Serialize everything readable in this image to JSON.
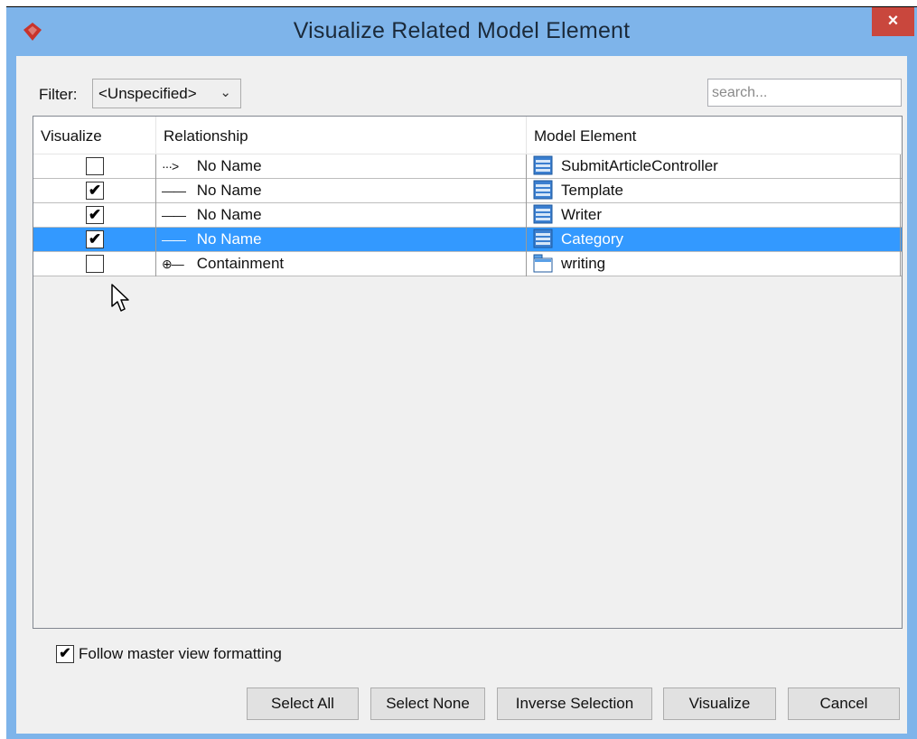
{
  "window": {
    "title": "Visualize Related Model Element",
    "close_label": "×"
  },
  "filter": {
    "label": "Filter:",
    "value": "<Unspecified>",
    "arrow": "⌄"
  },
  "search": {
    "placeholder": "search...",
    "value": ""
  },
  "table": {
    "columns": [
      "Visualize",
      "Relationship",
      "Model Element"
    ],
    "rows": [
      {
        "checked": false,
        "check_glyph": "",
        "rel_glyph": "···>",
        "relationship": "No Name",
        "element_icon": "class-icon",
        "model_element": "SubmitArticleController",
        "selected": false
      },
      {
        "checked": true,
        "check_glyph": "✔",
        "rel_glyph": "——",
        "relationship": "No Name",
        "element_icon": "class-icon",
        "model_element": "Template",
        "selected": false
      },
      {
        "checked": true,
        "check_glyph": "✔",
        "rel_glyph": "——",
        "relationship": "No Name",
        "element_icon": "class-icon",
        "model_element": "Writer",
        "selected": false
      },
      {
        "checked": true,
        "check_glyph": "✔",
        "rel_glyph": "——",
        "relationship": "No Name",
        "element_icon": "class-icon",
        "model_element": "Category",
        "selected": true
      },
      {
        "checked": false,
        "check_glyph": "",
        "rel_glyph": "⊕—",
        "relationship": "Containment",
        "element_icon": "package-icon",
        "model_element": "writing",
        "selected": false
      }
    ]
  },
  "follow_master": {
    "checked": true,
    "check_glyph": "✔",
    "label": "Follow master view formatting"
  },
  "buttons": {
    "select_all": "Select All",
    "select_none": "Select None",
    "inverse_selection": "Inverse Selection",
    "visualize": "Visualize",
    "cancel": "Cancel"
  },
  "colors": {
    "title_bar": "#7eb4ea",
    "close_button": "#c9473d",
    "selection": "#3399ff",
    "class_icon": "#3b7fd0"
  }
}
